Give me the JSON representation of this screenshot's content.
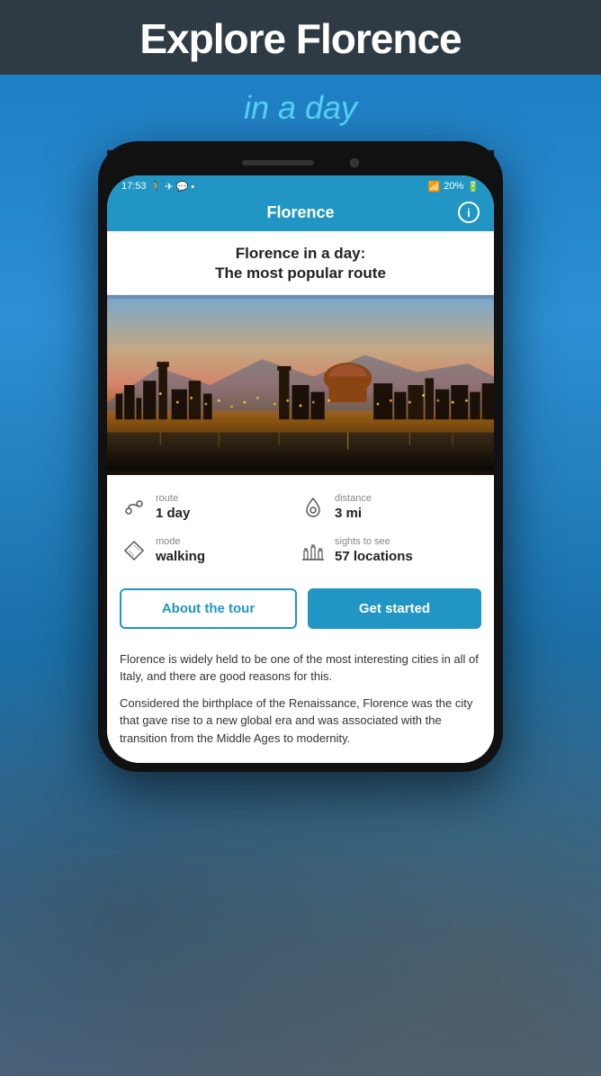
{
  "header": {
    "title": "Explore Florence",
    "subtitle": "in a day"
  },
  "phone": {
    "status_bar": {
      "time": "17:53",
      "icons_left": "🚶 ✈ 💬 •",
      "icons_right": "📶 20%"
    },
    "nav": {
      "title": "Florence",
      "info_icon": "i"
    },
    "tour": {
      "title_line1": "Florence in a day:",
      "title_line2": "The most popular route"
    },
    "stats": {
      "route_label": "route",
      "route_value": "1 day",
      "distance_label": "distance",
      "distance_value": "3 mi",
      "mode_label": "mode",
      "mode_value": "walking",
      "sights_label": "sights to see",
      "sights_value": "57 locations"
    },
    "buttons": {
      "about": "About the tour",
      "start": "Get started"
    },
    "description": {
      "para1": " Florence is widely held to be one of the most interesting cities in all of Italy, and there are good reasons for this.",
      "para2": "Considered the birthplace of the Renaissance, Florence was the city that gave rise to a new global era and was associated with the transition from the Middle Ages to modernity."
    }
  }
}
